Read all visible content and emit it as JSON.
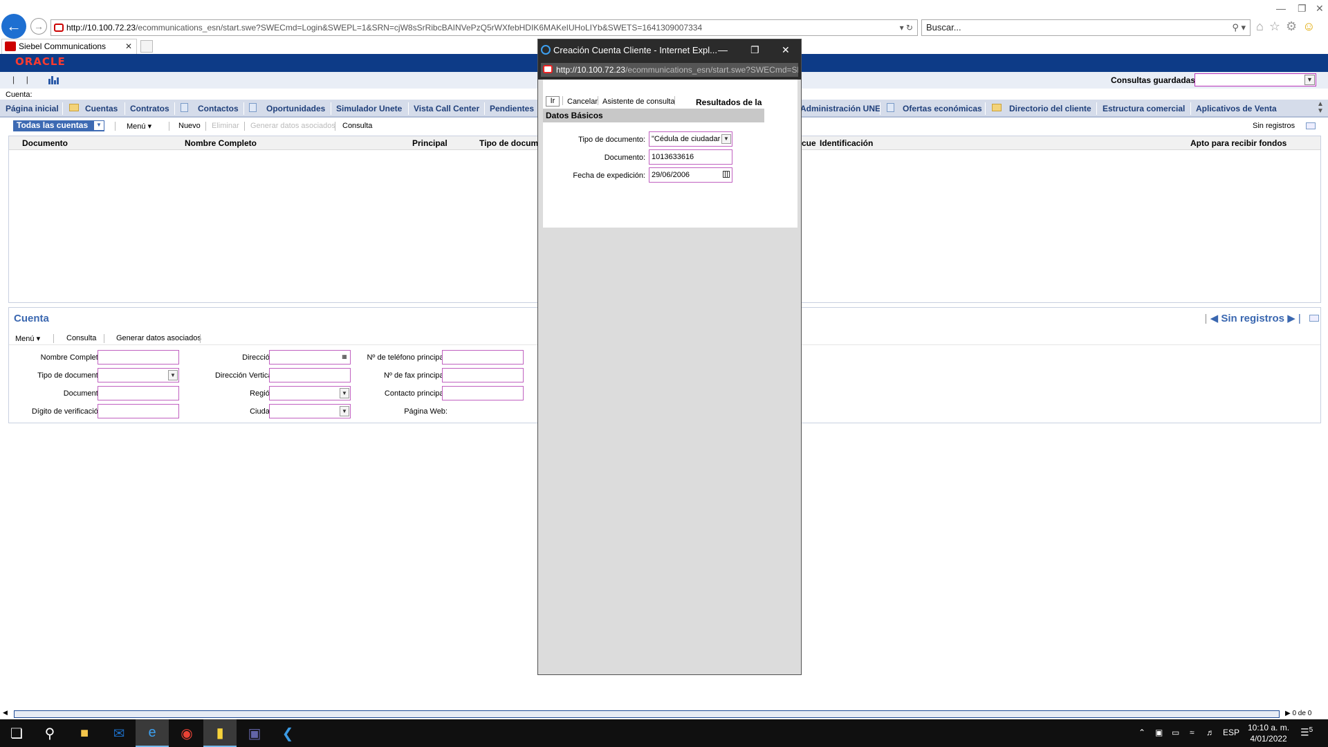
{
  "browser": {
    "url_host": "http://10.100.72.23",
    "url_rest": "/ecommunications_esn/start.swe?SWECmd=Login&SWEPL=1&SRN=cjW8sSrRibcBAINVePzQ5rWXfebHDIK6MAKeIUHoLIYb&SWETS=1641309007334",
    "search_placeholder": "Buscar...",
    "tab_title": "Siebel Communications"
  },
  "siebel": {
    "logo": "ORACLE",
    "consultas_label": "Consultas guardadas:",
    "cuenta_label": "Cuenta:",
    "screen_tabs": [
      "Página inicial",
      "Cuentas",
      "Contratos",
      "Contactos",
      "Oportunidades",
      "Simulador Unete",
      "Vista Call Center",
      "Pendientes",
      "Administración UNE",
      "Ofertas económicas",
      "Directorio del cliente",
      "Estructura comercial",
      "Aplicativos de Venta"
    ],
    "list": {
      "todas": "Todas las cuentas",
      "menu": "Menú",
      "nuevo": "Nuevo",
      "eliminar": "Eliminar",
      "generar": "Generar datos asociados",
      "consulta": "Consulta",
      "sin_registros": "Sin registros",
      "columns": [
        "Documento",
        "Nombre Completo",
        "Principal",
        "Tipo de docume",
        "cue",
        "Identificación",
        "Apto para recibir fondos"
      ]
    },
    "form": {
      "title": "Cuenta",
      "nav": "Sin registros",
      "menu": "Menú",
      "consulta": "Consulta",
      "generar": "Generar datos asociados",
      "labels": {
        "nombre": "Nombre Completo:",
        "tipo_doc": "Tipo de documento:",
        "documento": "Documento:",
        "digito": "Dígito de verificación:",
        "direccion": "Dirección:",
        "dir_vertical": "Dirección Vertical:",
        "region": "Región:",
        "ciudad": "Ciudad:",
        "telefono": "Nº de teléfono principal:",
        "fax": "Nº de fax principal:",
        "contacto": "Contacto principal:",
        "web": "Página Web:"
      }
    }
  },
  "popup": {
    "title": "Creación Cuenta Cliente - Internet Expl...",
    "url_host": "http://10.100.72.23",
    "url_rest": "/ecommunications_esn/start.swe?SWECmd=Sh",
    "ir": "Ir",
    "cancelar": "Cancelar",
    "asistente": "Asistente de consulta",
    "resultados": "Resultados de la consulta",
    "section": "Datos Básicos",
    "tipo_label": "Tipo de documento:",
    "tipo_value": "\"Cédula de ciudadar",
    "doc_label": "Documento:",
    "doc_value": "1013633616",
    "fecha_label": "Fecha de expedición:",
    "fecha_value": "29/06/2006"
  },
  "scrollbar": {
    "right_text": "0 de 0"
  },
  "taskbar": {
    "lang": "ESP",
    "time": "10:10 a. m.",
    "date": "4/01/2022",
    "notif": "5"
  }
}
